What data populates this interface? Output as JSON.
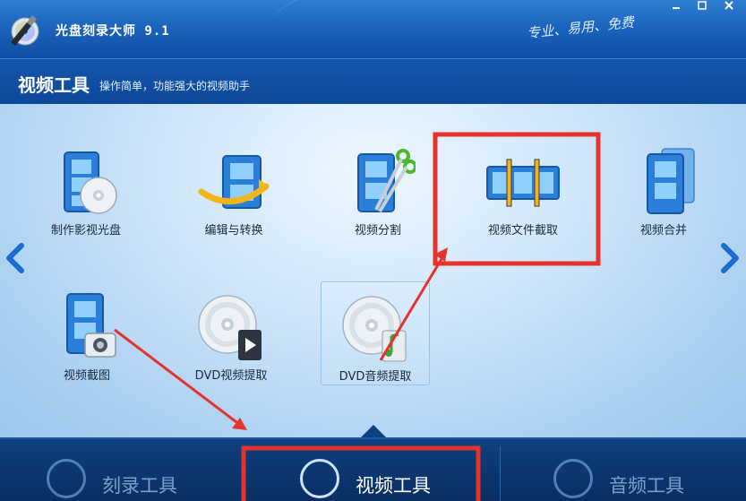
{
  "window": {
    "title": "光盘刻录大师 9.1",
    "slogan": "专业、易用、免费",
    "controls": [
      "minimize",
      "maximize",
      "close"
    ]
  },
  "section": {
    "title": "视频工具",
    "subtitle": "操作简单，功能强大的视频助手"
  },
  "tools": [
    {
      "label": "制作影视光盘",
      "icon": "film-disc-icon"
    },
    {
      "label": "编辑与转换",
      "icon": "film-convert-icon"
    },
    {
      "label": "视频分割",
      "icon": "film-scissors-icon"
    },
    {
      "label": "视频文件截取",
      "icon": "film-clip-icon"
    },
    {
      "label": "视频合并",
      "icon": "film-merge-icon"
    },
    {
      "label": "视频截图",
      "icon": "film-camera-icon"
    },
    {
      "label": "DVD视频提取",
      "icon": "dvd-video-icon"
    },
    {
      "label": "DVD音频提取",
      "icon": "dvd-audio-icon"
    }
  ],
  "bottom_tabs": [
    {
      "label": "刻录工具",
      "active": false
    },
    {
      "label": "视频工具",
      "active": true
    },
    {
      "label": "音频工具",
      "active": false
    }
  ],
  "colors": {
    "accent": "#1c64bd",
    "highlight_box": "#e5322d",
    "panel": "#cfe6fa"
  }
}
